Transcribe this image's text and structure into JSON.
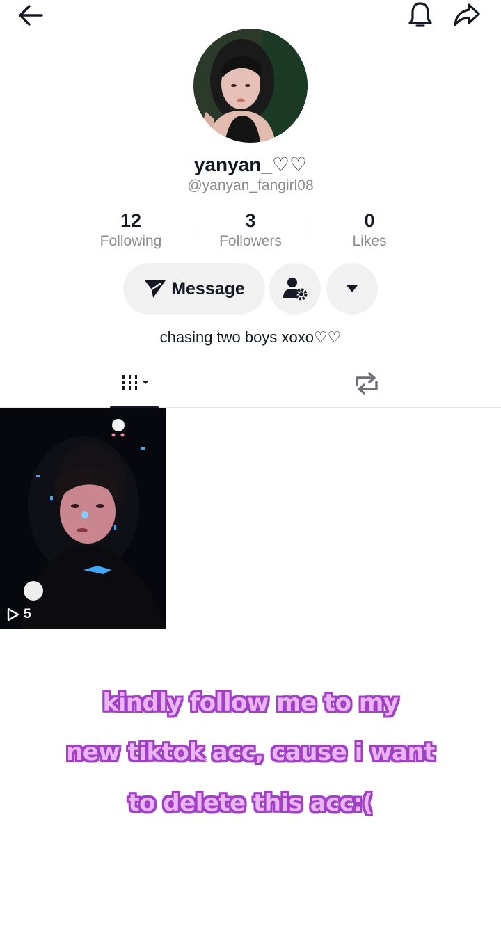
{
  "header": {
    "back_icon": "arrow-left-icon",
    "notification_icon": "bell-icon",
    "share_icon": "share-arrow-icon"
  },
  "profile": {
    "display_name": "yanyan_♡♡",
    "handle": "@yanyan_fangirl08",
    "bio": "chasing two boys xoxo♡♡"
  },
  "stats": {
    "following": {
      "value": "12",
      "label": "Following"
    },
    "followers": {
      "value": "3",
      "label": "Followers"
    },
    "likes": {
      "value": "0",
      "label": "Likes"
    }
  },
  "actions": {
    "message_label": "Message",
    "suggest_icon": "person-settings-icon",
    "more_icon": "caret-down-icon"
  },
  "tabs": {
    "videos_icon": "grid-bars-icon",
    "reposts_icon": "repost-icon"
  },
  "videos": [
    {
      "views": "5"
    }
  ],
  "overlay": {
    "line1": "kindly follow me to my",
    "line2": "new tiktok acc, cause i want",
    "line3": "to delete this acc:("
  },
  "colors": {
    "text_primary": "#161823",
    "text_secondary": "#8a8b91",
    "button_bg": "#f1f1f2",
    "overlay_fill": "#e9b5f2",
    "overlay_stroke": "#a23fc7"
  }
}
